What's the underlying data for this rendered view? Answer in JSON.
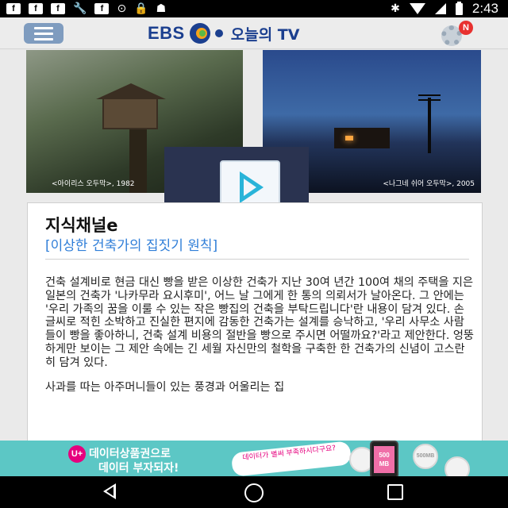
{
  "status_bar": {
    "time": "2:43",
    "notification_icons": [
      "facebook-icon",
      "facebook-icon",
      "facebook-icon",
      "wrench-icon",
      "facebook-icon",
      "disc-icon",
      "lock-icon",
      "android-icon"
    ],
    "notification_glyphs": [
      "f",
      "f",
      "f",
      "🔧",
      "f",
      "⊙",
      "🔒",
      "☗"
    ],
    "system_icons": [
      "bluetooth-icon",
      "wifi-icon",
      "signal-icon",
      "battery-icon"
    ],
    "bluetooth_glyph": "✱"
  },
  "header": {
    "logo_brand": "EBS",
    "logo_title": "오늘의 TV",
    "settings_badge": "N"
  },
  "photos": {
    "left_caption": "<아이리스 오두막>, 1982",
    "right_caption": "<나그네 쉬어 오두막>, 2005"
  },
  "article": {
    "title": "지식채널e",
    "subtitle": "[이상한 건축가의 집짓기 원칙]",
    "paragraphs": [
      "건축 설계비로 현금 대신 빵을 받은 이상한 건축가 지난 30여 년간 100여 채의 주택을 지은 일본의 건축가 '나카무라 요시후미', 어느 날 그에게 한 통의 의뢰서가 날아온다. 그 안에는 '우리 가족의 꿈을 이룰 수 있는 작은 빵집의 건축을 부탁드립니다'란 내용이 담겨 있다. 손글씨로 적힌 소박하고 진실한 편지에 감동한 건축가는 설계를 승낙하고, '우리 사무소 사람들이 빵을 좋아하니, 건축 설계 비용의 절반을 빵으로 주시면 어떨까요?'라고 제안한다. 엉뚱하게만 보이는 그 제안 속에는 긴 세월 자신만의 철학을 구축한 한 건축가의 신념이 고스란히 담겨 있다.",
      "사과를 따는 아주머니들이 있는 풍경과 어울리는 집"
    ]
  },
  "ad": {
    "brand_mark": "U+",
    "line1": "데이터상품권으로",
    "line2": "데이터 부자되자!",
    "bubble": "데이터가 별써 부족하시다구요?",
    "phone_label": "500 MB",
    "coin_label": "500MB"
  },
  "colors": {
    "brand_blue": "#1b3f8f",
    "subtitle_blue": "#2f7ed8",
    "menu_button": "#7f9cbf",
    "badge_red": "#e8312f",
    "ad_teal": "#5cc7c5",
    "play_cyan": "#29b4d9"
  },
  "nav": {
    "icons": [
      "back-icon",
      "home-icon",
      "recent-apps-icon"
    ]
  }
}
